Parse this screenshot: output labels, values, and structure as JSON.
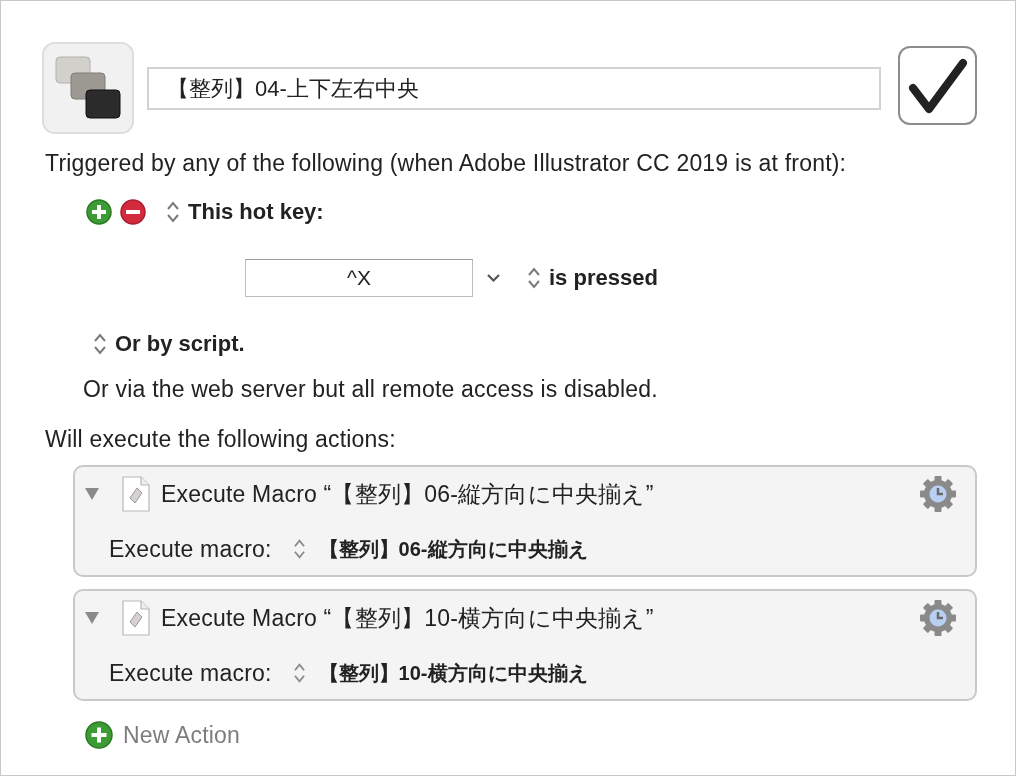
{
  "macro": {
    "name": "【整列】04-上下左右中央",
    "enabled": true
  },
  "trigger_intro": "Triggered by any of the following (when Adobe Illustrator CC 2019 is at front):",
  "triggers": [
    {
      "kind": "hot_key",
      "label": "This hot key:",
      "key": "^X",
      "condition": "is pressed"
    }
  ],
  "script_trigger": "Or by script.",
  "web_server_note": "Or via the web server but all remote access is disabled.",
  "actions_intro": "Will execute the following actions:",
  "actions": [
    {
      "title": "Execute Macro “【整列】06-縦方向に中央揃え”",
      "expanded": true,
      "param_label": "Execute macro:",
      "param_value": "【整列】06-縦方向に中央揃え"
    },
    {
      "title": "Execute Macro “【整列】10-横方向に中央揃え”",
      "expanded": true,
      "param_label": "Execute macro:",
      "param_value": "【整列】10-横方向に中央揃え"
    }
  ],
  "new_action": "New Action"
}
